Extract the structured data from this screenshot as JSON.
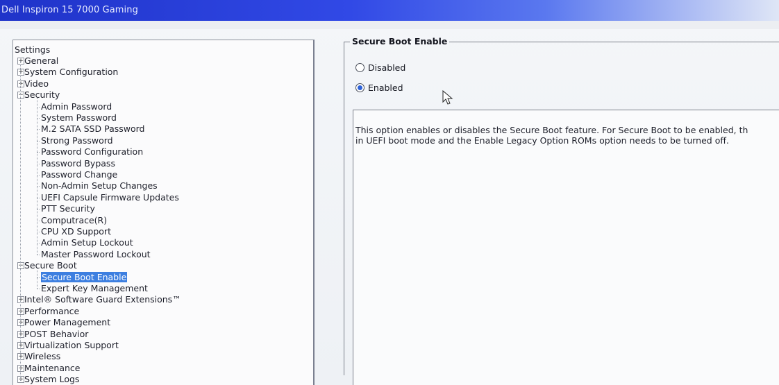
{
  "window": {
    "title": "Dell Inspiron 15 7000 Gaming"
  },
  "tree": {
    "root": "Settings",
    "items": [
      {
        "label": "General",
        "level": 1,
        "expander": "+",
        "selected": false
      },
      {
        "label": "System Configuration",
        "level": 1,
        "expander": "+",
        "selected": false
      },
      {
        "label": "Video",
        "level": 1,
        "expander": "+",
        "selected": false
      },
      {
        "label": "Security",
        "level": 1,
        "expander": "−",
        "selected": false
      },
      {
        "label": "Admin Password",
        "level": 2,
        "expander": "",
        "selected": false
      },
      {
        "label": "System Password",
        "level": 2,
        "expander": "",
        "selected": false
      },
      {
        "label": "M.2 SATA SSD Password",
        "level": 2,
        "expander": "",
        "selected": false
      },
      {
        "label": "Strong Password",
        "level": 2,
        "expander": "",
        "selected": false
      },
      {
        "label": "Password Configuration",
        "level": 2,
        "expander": "",
        "selected": false
      },
      {
        "label": "Password Bypass",
        "level": 2,
        "expander": "",
        "selected": false
      },
      {
        "label": "Password Change",
        "level": 2,
        "expander": "",
        "selected": false
      },
      {
        "label": "Non-Admin Setup Changes",
        "level": 2,
        "expander": "",
        "selected": false
      },
      {
        "label": "UEFI Capsule Firmware Updates",
        "level": 2,
        "expander": "",
        "selected": false
      },
      {
        "label": "PTT Security",
        "level": 2,
        "expander": "",
        "selected": false
      },
      {
        "label": "Computrace(R)",
        "level": 2,
        "expander": "",
        "selected": false
      },
      {
        "label": "CPU XD Support",
        "level": 2,
        "expander": "",
        "selected": false
      },
      {
        "label": "Admin Setup Lockout",
        "level": 2,
        "expander": "",
        "selected": false
      },
      {
        "label": "Master Password Lockout",
        "level": 2,
        "expander": "",
        "selected": false
      },
      {
        "label": "Secure Boot",
        "level": 1,
        "expander": "−",
        "selected": false
      },
      {
        "label": "Secure Boot Enable",
        "level": 2,
        "expander": "",
        "selected": true
      },
      {
        "label": "Expert Key Management",
        "level": 2,
        "expander": "",
        "selected": false
      },
      {
        "label": "Intel® Software Guard Extensions™",
        "level": 1,
        "expander": "+",
        "selected": false
      },
      {
        "label": "Performance",
        "level": 1,
        "expander": "+",
        "selected": false
      },
      {
        "label": "Power Management",
        "level": 1,
        "expander": "+",
        "selected": false
      },
      {
        "label": "POST Behavior",
        "level": 1,
        "expander": "+",
        "selected": false
      },
      {
        "label": "Virtualization Support",
        "level": 1,
        "expander": "+",
        "selected": false
      },
      {
        "label": "Wireless",
        "level": 1,
        "expander": "+",
        "selected": false
      },
      {
        "label": "Maintenance",
        "level": 1,
        "expander": "+",
        "selected": false
      },
      {
        "label": "System Logs",
        "level": 1,
        "expander": "+",
        "selected": false
      }
    ]
  },
  "panel": {
    "group_title": "Secure Boot Enable",
    "options": [
      {
        "label": "Disabled",
        "checked": false
      },
      {
        "label": "Enabled",
        "checked": true
      }
    ],
    "description": [
      "This option enables or disables the Secure Boot feature. For Secure Boot to be enabled, th",
      "in UEFI boot mode and the Enable Legacy Option ROMs option needs to be turned off."
    ]
  },
  "colors": {
    "selection": "#3d7fe0",
    "titlebar": "#1f33c9",
    "radio_fill": "#2d62d8"
  }
}
